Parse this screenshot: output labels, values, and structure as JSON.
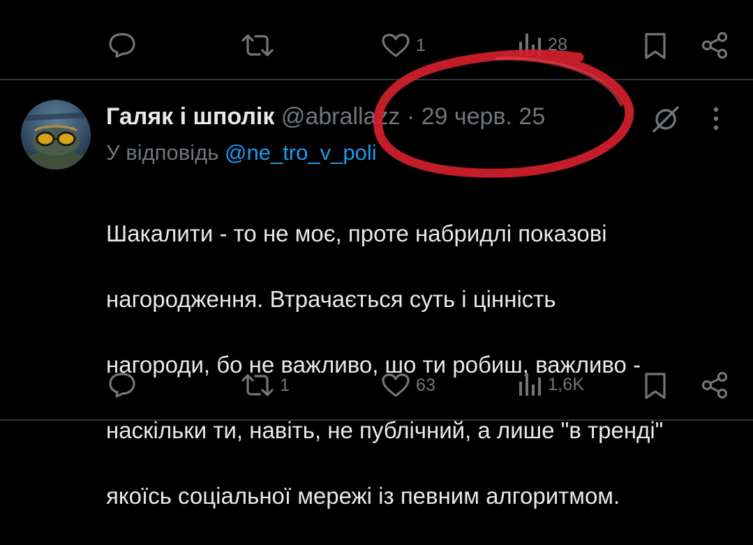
{
  "top_actions": {
    "reply_count": "",
    "repost_count": "",
    "like_count": "1",
    "views_count": "28"
  },
  "tweet": {
    "author_name": "Галяк і шполік",
    "handle": "@abrallazz",
    "separator": "·",
    "date": "29 черв. 25",
    "reply_prefix": "У відповідь",
    "reply_to": "@ne_tro_v_poli",
    "text_lines": [
      "Шакалити - то не моє, проте набридлі показові",
      "нагородження. Втрачається суть і цінність",
      "нагороди, бо не важливо, шо ти робиш, важливо -",
      "наскільки ти, навіть, не публічний, а лише \"в тренді\"",
      "якоїсь соціальної мережі із певним алгоритмом."
    ],
    "actions": {
      "reply_count": "",
      "repost_count": "1",
      "like_count": "63",
      "views_count": "1,6K"
    }
  },
  "icons": [
    "reply-icon",
    "repost-icon",
    "like-icon",
    "views-icon",
    "bookmark-icon",
    "share-icon",
    "grok-icon",
    "more-icon"
  ],
  "colors": {
    "background": "#000000",
    "text": "#e7e9ea",
    "muted": "#71767b",
    "mention": "#1d9bf0",
    "annotation_circle": "#d4202c"
  }
}
